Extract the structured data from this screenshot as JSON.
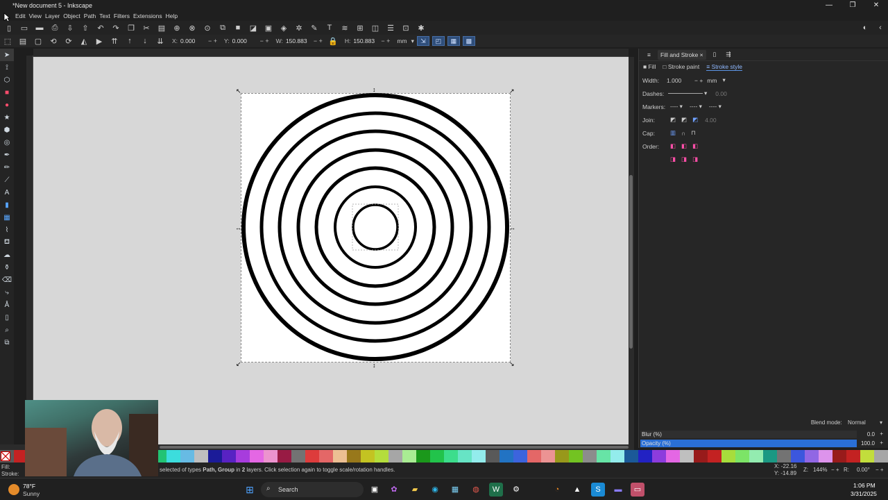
{
  "window": {
    "title": "*New document 5 - Inkscape",
    "controls": [
      "—",
      "❐",
      "✕"
    ]
  },
  "menu": [
    "Edit",
    "View",
    "Layer",
    "Object",
    "Path",
    "Text",
    "Filters",
    "Extensions",
    "Help"
  ],
  "controls_bar": {
    "x_label": "X:",
    "x_value": "0.000",
    "y_label": "Y:",
    "y_value": "0.000",
    "w_label": "W:",
    "w_value": "150.883",
    "h_label": "H:",
    "h_value": "150.883",
    "unit": "mm"
  },
  "dock": {
    "tab_fill_stroke": "Fill and Stroke",
    "subtabs": {
      "fill": "Fill",
      "stroke_paint": "Stroke paint",
      "stroke_style": "Stroke style"
    },
    "width_label": "Width:",
    "width_value": "1.000",
    "width_unit": "mm",
    "dashes_label": "Dashes:",
    "dashes_value": "0.00",
    "markers_label": "Markers:",
    "join_label": "Join:",
    "join_value": "4.00",
    "cap_label": "Cap:",
    "order_label": "Order:",
    "blend_label": "Blend mode:",
    "blend_value": "Normal",
    "blur_label": "Blur (%)",
    "blur_value": "0.0",
    "opacity_label": "Opacity (%)",
    "opacity_value": "100.0",
    "opacity_fraction": 1.0
  },
  "status": {
    "fill_label": "Fill:",
    "stroke_label": "Stroke:",
    "message_prefix": "selected of types ",
    "message_types": "Path, Group",
    "message_mid": " in ",
    "message_layers": "2",
    "message_suffix": " layers. Click selection again to toggle scale/rotation handles.",
    "coord_x": "X: -22.16",
    "coord_y": "Y: -14.89",
    "zoom_label": "Z:",
    "zoom": "144%",
    "rot_label": "R:",
    "rotation": "0.00°"
  },
  "taskbar": {
    "weather_temp": "78°F",
    "weather_desc": "Sunny",
    "search_placeholder": "Search",
    "time": "1:06 PM",
    "date": "3/31/2025"
  },
  "colors": {
    "accent": "#2a6fd6",
    "canvas": "#d7d7d7",
    "ring": "#000000"
  }
}
